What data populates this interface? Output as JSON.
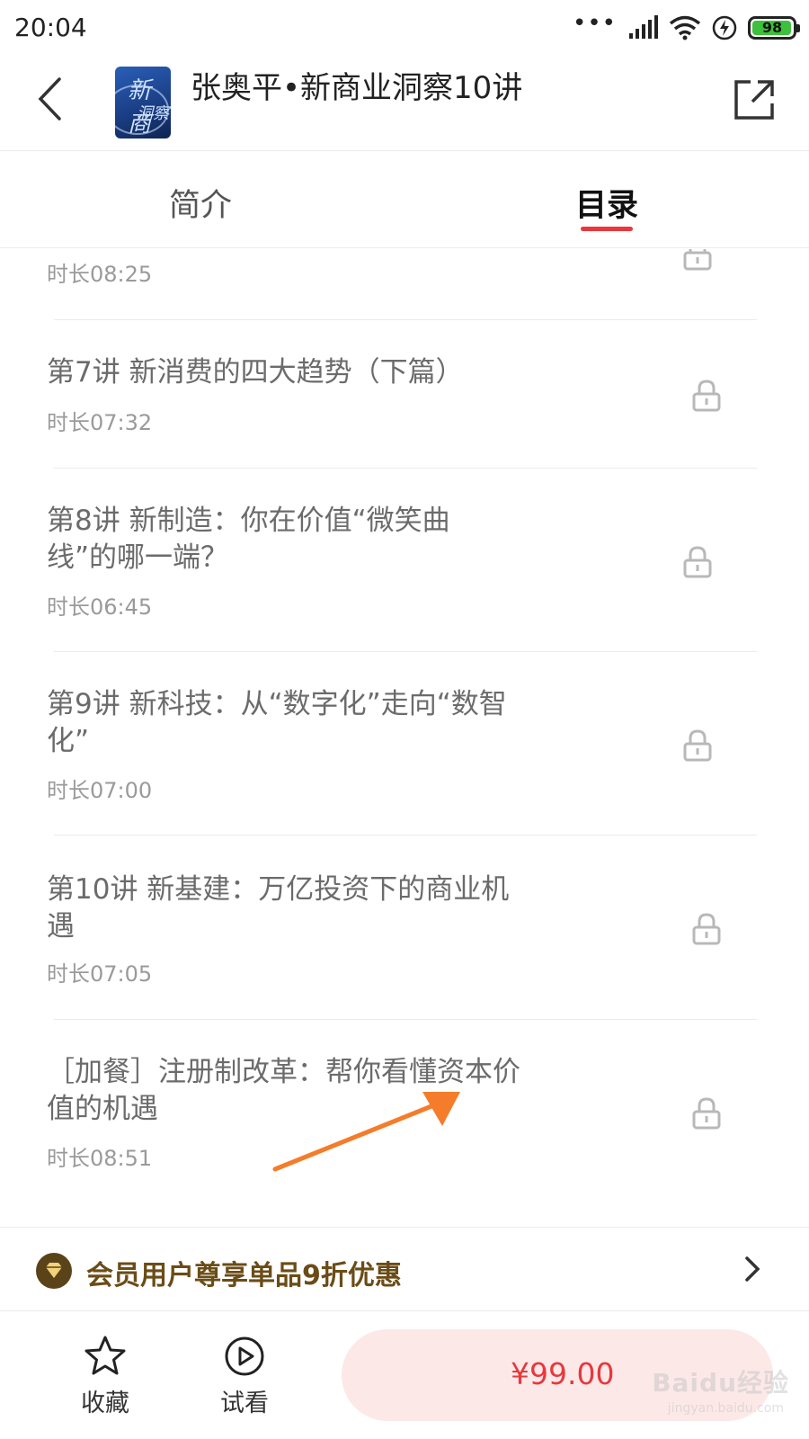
{
  "status_bar": {
    "time": "20:04",
    "battery_level": "98",
    "battery_fraction": 0.98,
    "icons": [
      "dots-icon",
      "signal-icon",
      "wifi-icon",
      "charging-icon",
      "battery-icon"
    ]
  },
  "header": {
    "title": "张奥平•新商业洞察10讲",
    "cover_text": "新商",
    "cover_text2": "洞察"
  },
  "tabs": [
    {
      "label": "简介",
      "active": false
    },
    {
      "label": "目录",
      "active": true
    }
  ],
  "accent_color": "#e8383d",
  "catalog": {
    "items": [
      {
        "title": "",
        "duration": "时长08:25",
        "locked": true
      },
      {
        "title": "第7讲 新消费的四大趋势（下篇）",
        "duration": "时长07:32",
        "locked": true
      },
      {
        "title": "第8讲 新制造：你在价值“微笑曲线”的哪一端？",
        "duration": "时长06:45",
        "locked": true
      },
      {
        "title": "第9讲 新科技：从“数字化”走向“数智化”",
        "duration": "时长07:00",
        "locked": true
      },
      {
        "title": "第10讲 新基建：万亿投资下的商业机遇",
        "duration": "时长07:05",
        "locked": true
      },
      {
        "title": "［加餐］注册制改革：帮你看懂资本价值的机遇",
        "duration": "时长08:51",
        "locked": true
      }
    ]
  },
  "member_banner": {
    "text": "会员用户尊享单品9折优惠",
    "color": "#6b4c17"
  },
  "bottom_bar": {
    "favorite_label": "收藏",
    "trial_label": "试看",
    "price": "¥99.00",
    "price_color": "#e5393d"
  },
  "watermark": {
    "text": "Baidu经验",
    "sub": "jingyan.baidu.com"
  }
}
